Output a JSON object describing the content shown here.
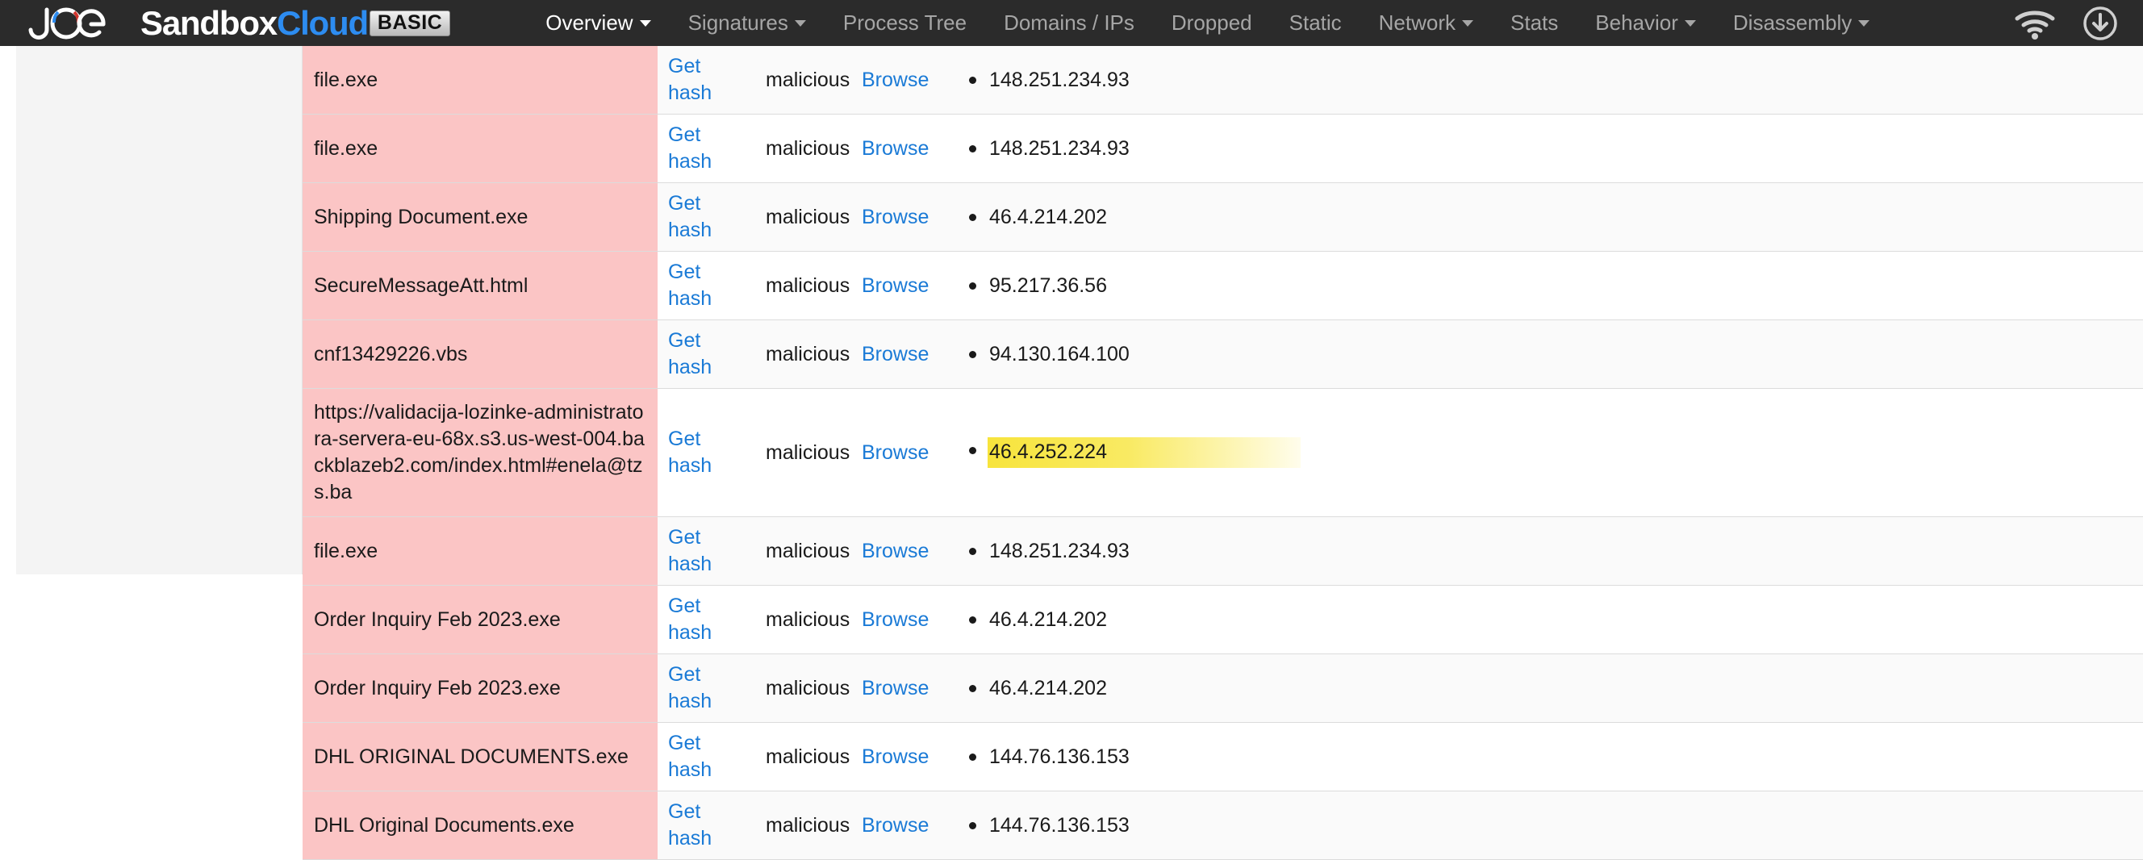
{
  "navbar": {
    "logo": {
      "icon": "joe-logo-icon",
      "text_sandbox": "Sandbox",
      "text_cloud": "Cloud",
      "badge": "BASIC"
    },
    "items": [
      {
        "label": "Overview",
        "active": true,
        "caret": true
      },
      {
        "label": "Signatures",
        "active": false,
        "caret": true
      },
      {
        "label": "Process Tree",
        "active": false,
        "caret": false
      },
      {
        "label": "Domains / IPs",
        "active": false,
        "caret": false
      },
      {
        "label": "Dropped",
        "active": false,
        "caret": false
      },
      {
        "label": "Static",
        "active": false,
        "caret": false
      },
      {
        "label": "Network",
        "active": false,
        "caret": true
      },
      {
        "label": "Stats",
        "active": false,
        "caret": false
      },
      {
        "label": "Behavior",
        "active": false,
        "caret": true
      },
      {
        "label": "Disassembly",
        "active": false,
        "caret": true
      }
    ],
    "icons": [
      {
        "name": "antenna-signal-icon"
      },
      {
        "name": "download-icon"
      }
    ]
  },
  "colors": {
    "navbar_bg": "#2b2b2b",
    "accent_link": "#1a7ad6",
    "cloud_blue": "#2d8cf0",
    "row_malicious_bg": "#fbc5c5",
    "highlight_yellow": "#f7e43c"
  },
  "table": {
    "rows": [
      {
        "name": "file.exe",
        "hash": "Get hash",
        "verdict": "malicious",
        "browse": "Browse",
        "ip": "148.251.234.93",
        "highlight": false
      },
      {
        "name": "file.exe",
        "hash": "Get hash",
        "verdict": "malicious",
        "browse": "Browse",
        "ip": "148.251.234.93",
        "highlight": false
      },
      {
        "name": "Shipping Document.exe",
        "hash": "Get hash",
        "verdict": "malicious",
        "browse": "Browse",
        "ip": "46.4.214.202",
        "highlight": false
      },
      {
        "name": "SecureMessageAtt.html",
        "hash": "Get hash",
        "verdict": "malicious",
        "browse": "Browse",
        "ip": "95.217.36.56",
        "highlight": false
      },
      {
        "name": "cnf13429226.vbs",
        "hash": "Get hash",
        "verdict": "malicious",
        "browse": "Browse",
        "ip": "94.130.164.100",
        "highlight": false
      },
      {
        "name": "https://validacija-lozinke-administratora-servera-eu-68x.s3.us-west-004.backblazeb2.com/index.html#enela@tzs.ba",
        "hash": "Get hash",
        "verdict": "malicious",
        "browse": "Browse",
        "ip": "46.4.252.224",
        "highlight": true
      },
      {
        "name": "file.exe",
        "hash": "Get hash",
        "verdict": "malicious",
        "browse": "Browse",
        "ip": "148.251.234.93",
        "highlight": false
      },
      {
        "name": "Order Inquiry Feb 2023.exe",
        "hash": "Get hash",
        "verdict": "malicious",
        "browse": "Browse",
        "ip": "46.4.214.202",
        "highlight": false
      },
      {
        "name": "Order Inquiry Feb 2023.exe",
        "hash": "Get hash",
        "verdict": "malicious",
        "browse": "Browse",
        "ip": "46.4.214.202",
        "highlight": false
      },
      {
        "name": "DHL ORIGINAL DOCUMENTS.exe",
        "hash": "Get hash",
        "verdict": "malicious",
        "browse": "Browse",
        "ip": "144.76.136.153",
        "highlight": false
      },
      {
        "name": "DHL Original Documents.exe",
        "hash": "Get hash",
        "verdict": "malicious",
        "browse": "Browse",
        "ip": "144.76.136.153",
        "highlight": false
      }
    ]
  }
}
